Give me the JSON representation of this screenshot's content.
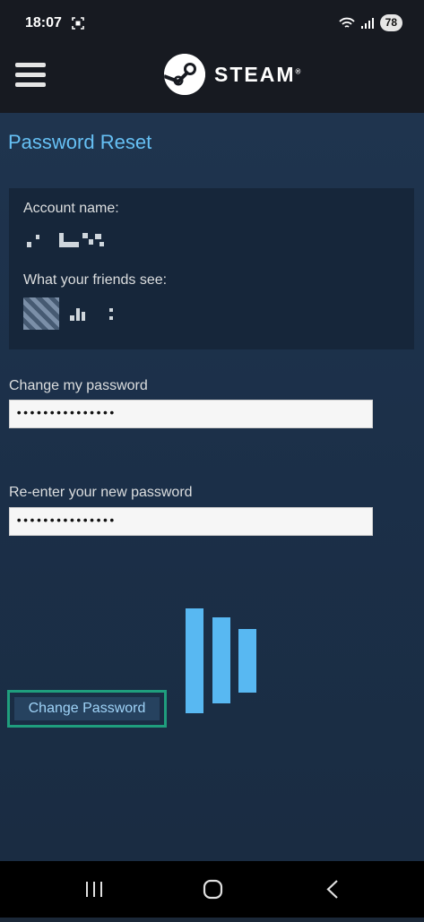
{
  "status_bar": {
    "time": "18:07",
    "battery": "78"
  },
  "header": {
    "logo_text": "STEAM",
    "logo_registered": "®"
  },
  "page": {
    "title": "Password Reset"
  },
  "account": {
    "name_label": "Account name:",
    "friends_label": "What your friends see:"
  },
  "form": {
    "new_password_label": "Change my password",
    "new_password_value": "•••••••••••••••",
    "reenter_label": "Re-enter your new password",
    "reenter_value": "•••••••••••••••",
    "submit_label": "Change Password"
  },
  "icons": {
    "menu": "hamburger-menu-icon",
    "logo": "steam-logo-icon",
    "loading": "loading-throbber-icon",
    "recents": "recents-icon",
    "home": "home-icon",
    "back": "back-icon"
  },
  "colors": {
    "accent": "#66c0f4",
    "header_bg": "#171a21",
    "page_bg": "#1b2838",
    "highlight": "#1f9e7d"
  }
}
